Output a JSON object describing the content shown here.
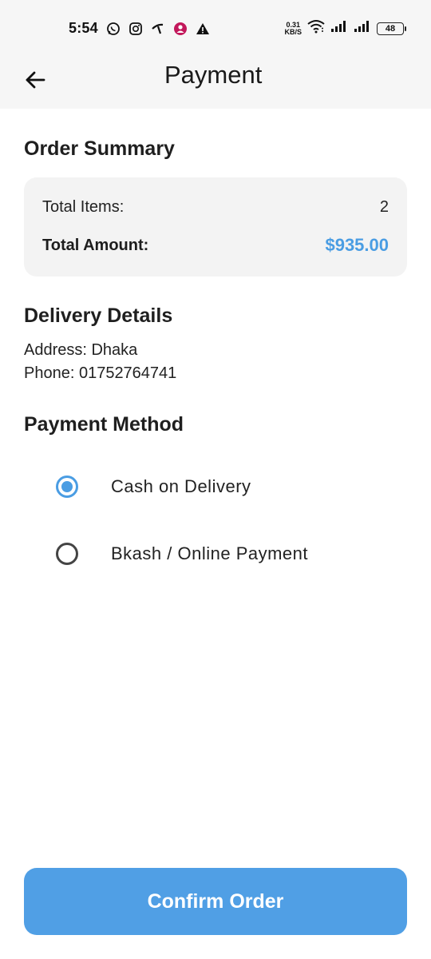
{
  "status_bar": {
    "time": "5:54",
    "net_speed_value": "0.31",
    "net_speed_unit": "KB/S",
    "battery": "48",
    "icons": [
      "whatsapp-icon",
      "instagram-icon",
      "carrier-app-icon",
      "messenger-icon",
      "warning-icon",
      "wifi-icon",
      "signal-icon",
      "signal-icon",
      "battery-icon"
    ]
  },
  "app_bar": {
    "title": "Payment",
    "back_icon": "arrow-left-icon"
  },
  "order_summary": {
    "title": "Order Summary",
    "total_items_label": "Total Items:",
    "total_items_value": "2",
    "total_amount_label": "Total Amount:",
    "total_amount_value": "$935.00"
  },
  "delivery": {
    "title": "Delivery Details",
    "address": "Address: Dhaka",
    "phone": "Phone: 01752764741"
  },
  "payment_method": {
    "title": "Payment Method",
    "options": [
      {
        "label": "Cash on Delivery",
        "selected": true
      },
      {
        "label": "Bkash / Online Payment",
        "selected": false
      }
    ]
  },
  "confirm_button": "Confirm Order",
  "colors": {
    "accent": "#4a9de3",
    "button": "#509fe5",
    "card_bg": "#f3f3f3",
    "bar_bg": "#f6f6f6"
  }
}
